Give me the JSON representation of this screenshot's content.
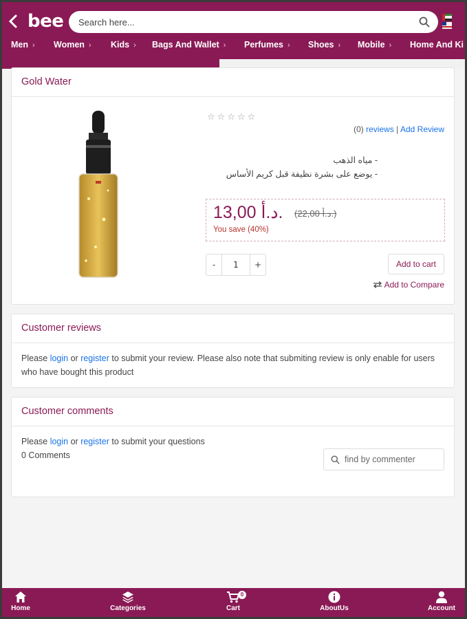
{
  "header": {
    "logo": "bee",
    "search_placeholder": "Search here..."
  },
  "nav": [
    "Men",
    "Women",
    "Kids",
    "Bags And Wallet",
    "Perfumes",
    "Shoes",
    "Mobile",
    "Home And Ki"
  ],
  "product": {
    "title": "Gold Water",
    "review_count": "(0)",
    "reviews_label": "reviews",
    "separator": "|",
    "add_review_label": "Add Review",
    "description_lines": [
      "- مياه الذهب",
      "- يوضع على بشرة نظيفة قبل كريم الأساس"
    ],
    "price": "13,00 د.أ.",
    "old_price": "(22,00 د.أ.)",
    "save_text": "You save (40%)",
    "quantity": "1",
    "minus": "-",
    "plus": "+",
    "add_to_cart": "Add to cart",
    "add_to_compare": "Add to Compare",
    "rating": 0
  },
  "reviews": {
    "title": "Customer reviews",
    "text_1": "Please ",
    "login": "login",
    "text_2": " or ",
    "register": "register",
    "text_3": " to submit your review. Please also note that submiting review is only enable for users who have bought this product"
  },
  "comments": {
    "title": "Customer comments",
    "text_1": "Please ",
    "login": "login",
    "text_2": " or ",
    "register": "register",
    "text_3": " to submit your questions",
    "count": "0 Comments",
    "find_placeholder": "find by commenter"
  },
  "bottom_nav": [
    {
      "label": "Home",
      "icon": "home-icon"
    },
    {
      "label": "Categories",
      "icon": "layers-icon"
    },
    {
      "label": "Cart",
      "icon": "cart-icon",
      "badge": "0"
    },
    {
      "label": "AboutUs",
      "icon": "info-icon"
    },
    {
      "label": "Account",
      "icon": "user-icon"
    }
  ],
  "colors": {
    "brand": "#8a1a55",
    "link": "#1a73e8",
    "save": "#b5342c"
  }
}
